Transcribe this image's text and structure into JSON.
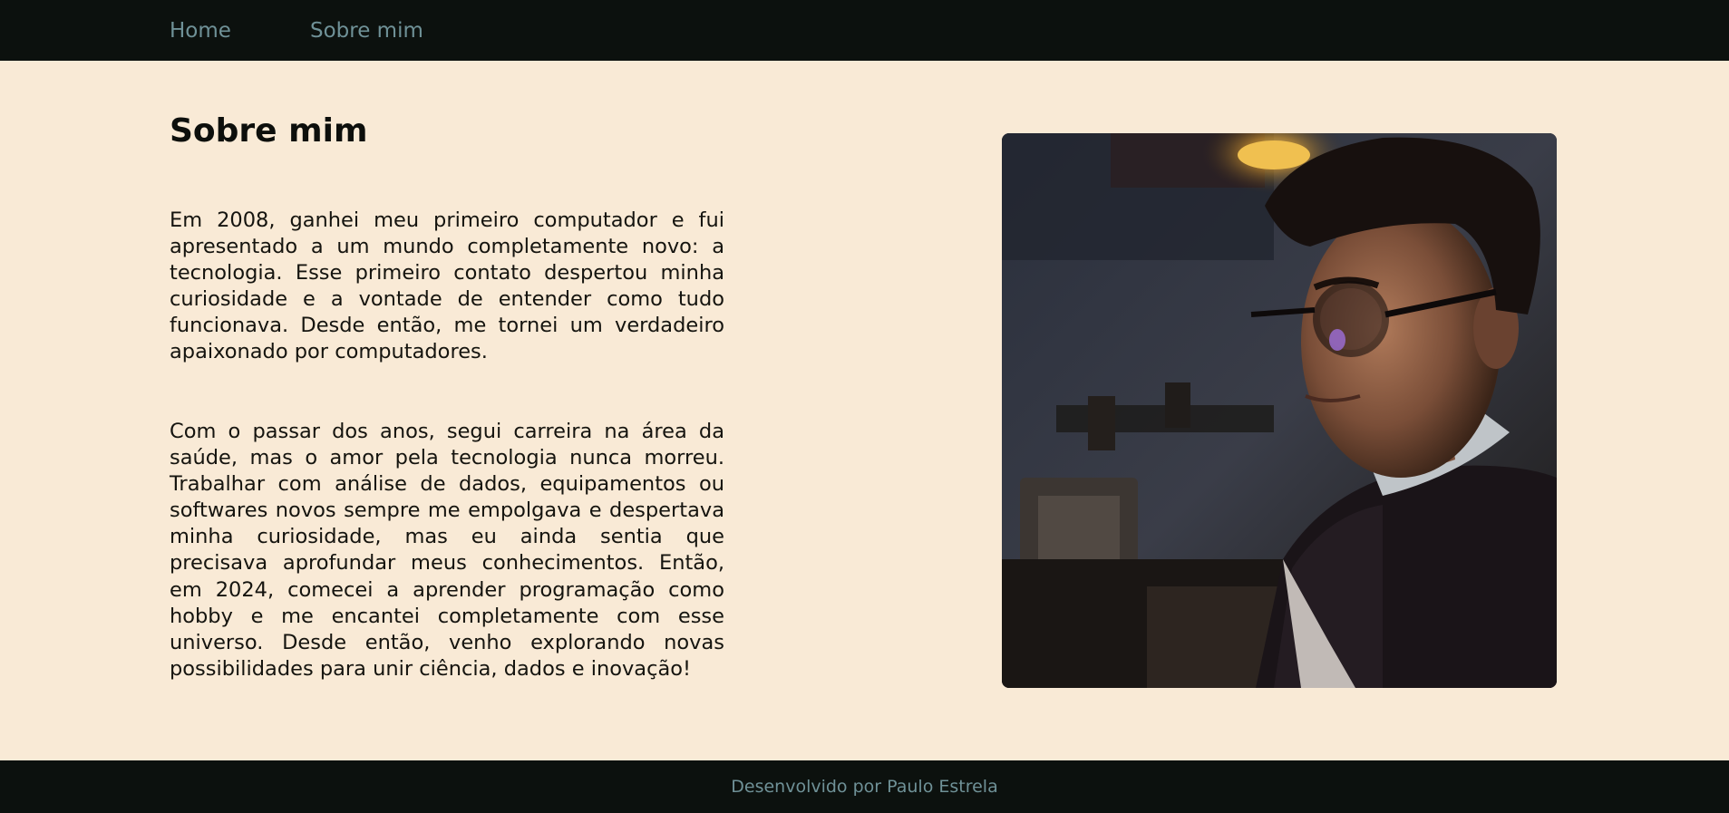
{
  "nav": {
    "items": [
      {
        "label": "Home"
      },
      {
        "label": "Sobre mim"
      }
    ]
  },
  "main": {
    "title": "Sobre mim",
    "paragraphs": [
      "Em 2008, ganhei meu primeiro computador e fui apresentado a um mundo completamente novo: a tecnologia. Esse primeiro contato despertou minha curiosidade e a vontade de entender como tudo funcionava. Desde então, me tornei um verdadeiro apaixonado por computadores.",
      "Com o passar dos anos, segui carreira na área da saúde, mas o amor pela tecnologia nunca morreu. Trabalhar com análise de dados, equipamentos ou softwares novos sempre me empolgava e despertava minha curiosidade, mas eu ainda sentia que precisava aprofundar meus conhecimentos. Então, em 2024, comecei a aprender programação como hobby e me encantei completamente com esse universo. Desde então, venho explorando novas possibilidades para unir ciência, dados e inovação!"
    ]
  },
  "footer": {
    "text": "Desenvolvido por Paulo Estrela"
  },
  "colors": {
    "background": "#f9ead6",
    "bar": "#0c110e",
    "link": "#6f9197",
    "text": "#0d0f0c"
  }
}
